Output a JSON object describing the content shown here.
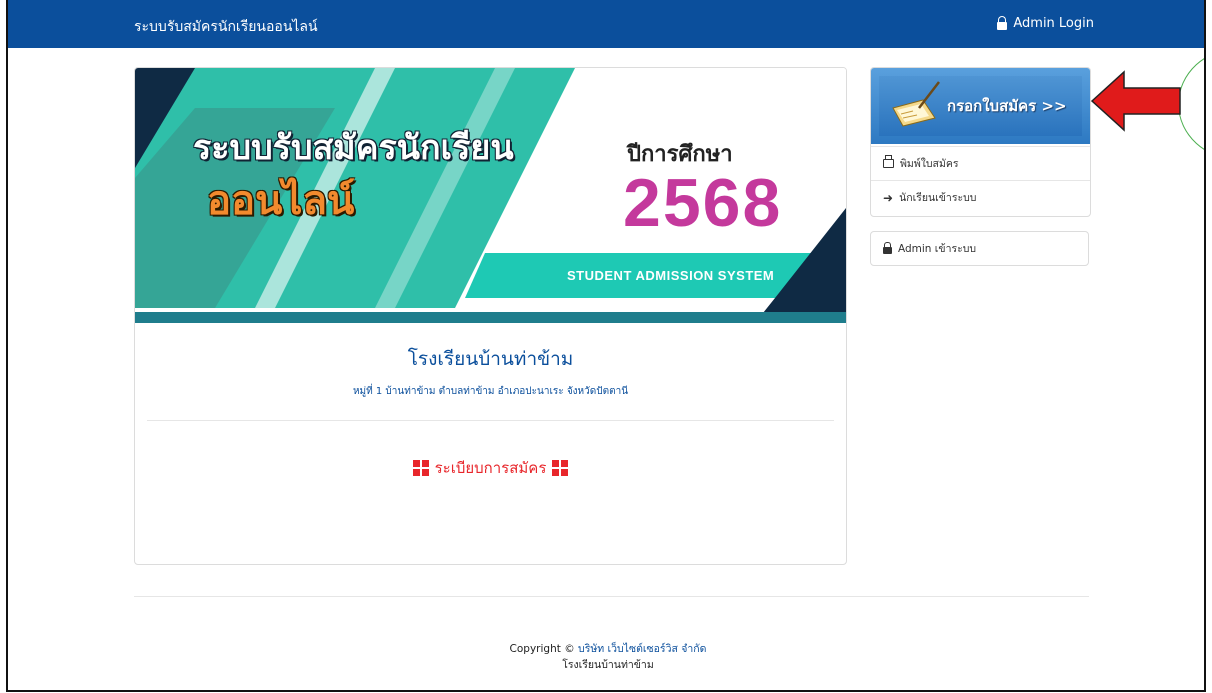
{
  "navbar": {
    "brand": "ระบบรับสมัครนักเรียนออนไลน์",
    "admin_login": "Admin Login"
  },
  "banner": {
    "title_line1": "ระบบรับสมัครนักเรียน",
    "title_line2": "ออนไลน์",
    "year_label": "ปีการศึกษา",
    "year": "2568",
    "subtitle": "STUDENT ADMISSION SYSTEM"
  },
  "school": {
    "name": "โรงเรียนบ้านท่าข้าม",
    "address": "หมู่ที่ 1 บ้านท่าข้าม ตำบลท่าข้าม อำเภอปะนาเระ จังหวัดปัตตานี"
  },
  "rules": {
    "title": "ระเบียบการสมัคร"
  },
  "sidebar": {
    "apply_label": "กรอกใบสมัคร >>",
    "items": [
      {
        "label": "พิมพ์ใบสมัคร",
        "icon": "print-icon"
      },
      {
        "label": "นักเรียนเข้าระบบ",
        "icon": "login-icon"
      }
    ],
    "admin_label": "Admin เข้าระบบ"
  },
  "footer": {
    "copyright_prefix": "Copyright ©",
    "company": "บริษัท เว็บไซต์เซอร์วิส จำกัด",
    "school": "โรงเรียนบ้านท่าข้าม"
  },
  "colors": {
    "navbar": "#0b4f9c",
    "accent_red": "#e8262b",
    "banner_teal": "#1fc4b0",
    "year": "#c4399c"
  }
}
